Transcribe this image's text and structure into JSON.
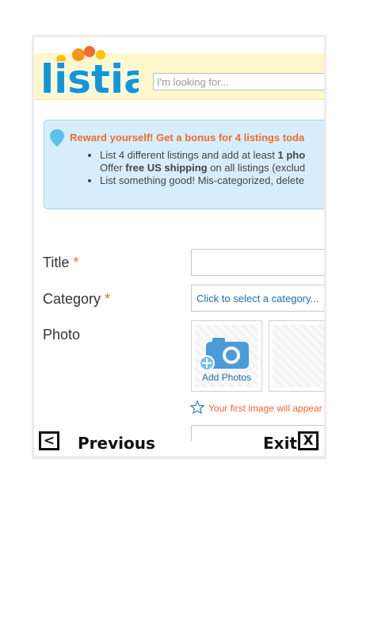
{
  "header": {
    "logo_text": "listia",
    "search_placeholder": "I'm looking for..."
  },
  "bonus": {
    "title": "Reward yourself! Get a bonus for 4 listings toda",
    "items": [
      {
        "text_a": "List 4 different listings and add at least ",
        "bold": "1 pho",
        "text_b_pre": "Offer ",
        "text_b_bold": "free US shipping",
        "text_b_post": " on all listings (exclud"
      },
      {
        "text": "List something good! Mis-categorized, delete"
      }
    ]
  },
  "form": {
    "title_label": "Title",
    "category_label": "Category",
    "required_mark": "*",
    "category_placeholder": "Click to select a category...",
    "photo_label": "Photo",
    "add_photos_label": "Add Photos",
    "first_image_note": "Your first image will appear"
  },
  "nav": {
    "previous_icon": "<",
    "previous_label": "Previous",
    "exit_label": "Exit",
    "exit_icon": "X"
  },
  "colors": {
    "accent_orange": "#f26a2d",
    "link_blue": "#1c6fb1",
    "bonus_bg": "#d6eefb",
    "header_bg": "#fff8cc"
  }
}
